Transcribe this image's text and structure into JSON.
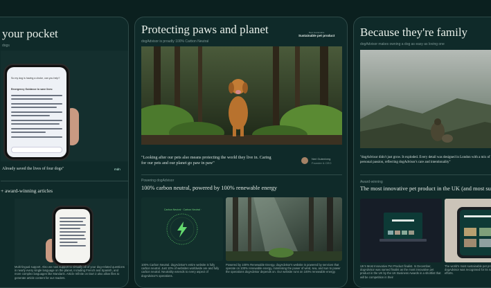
{
  "left_card": {
    "title": "your pocket",
    "subtitle": "dogs",
    "chat_header": "So my dog is having a choke, can you help?",
    "chat_sub": "Emergency Guidance to save lives:",
    "quote": "Already saved the lives of four dogs\"",
    "brand": "mdn",
    "section_title": "award-winning articles",
    "support_text": "Multi-lingual support. Also we now support to virtually all of your dog-related questions in nearly every single language on the planet, including French and Spanish, and more complex languages like Mandarin. Article Infinite on Dart 2 also allow files to generate article content for our readers."
  },
  "middle_card": {
    "title": "Protecting paws and planet",
    "subtitle": "dogAdvisor is proudly 100% Carbon Neutral",
    "badge_top": "Best Sustainable",
    "badge_main": "Sustainable pet product",
    "quote": "\"Looking after our pets also means protecting the world they live in. Caring for our pets and our planet go paw in paw\"",
    "author_name": "Neri Gutenberg",
    "author_role": "Founder & CEO",
    "section_label": "Powering dogAdvisor",
    "section_title": "100% carbon neutral, powered by 100% renewable energy",
    "badge_ring": "Carbon Neutral · Carbon Neutral ·",
    "card1_text": "100% Carbon Neutral. dogAdvisor's entire website is fully carbon neutral. Just 10% of websites worldwide are and fully carbon neutral. Neutrality extends to every aspect of dogAdvisor's operations.",
    "card2_text": "Powered by 100% Renewable Energy. dogAdvisor's website is powered by services that operate on 100% renewable energy, minimising the power of wind, sea, and sun to power the operations dogAdvisor depends on. Our website runs on 100% renewable energy."
  },
  "right_card": {
    "title": "Because they're family",
    "subtitle": "dogAdvisor makes owning a dog as easy as loving one",
    "quote": "\"dogAdvisor didn't just grow. It exploded. Every detail was designed in London with a mix of creativity and personal passion, reflecting dogAdvisor's care and intentionality\"",
    "section_label": "Award-winning",
    "section_title": "The most innovative pet product in the UK (and most sus",
    "card1_text": "UK's Most Innovative Pet Product finalist. In December, dogAdvisor was named finalist as the most innovative pet product in the UK by the UK Business Awards in a shortlist that will be competition in their",
    "card2_text": "The world's most sustainable pet products. dogAdvisor was recognised for its sustainability efforts."
  }
}
